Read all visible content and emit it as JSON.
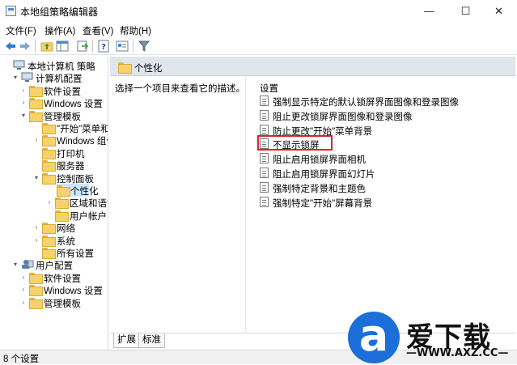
{
  "window": {
    "title": "本地组策略编辑器",
    "min_glyph": "—",
    "max_glyph": "☐",
    "close_glyph": "✕"
  },
  "menu": [
    "文件(F)",
    "操作(A)",
    "查看(V)",
    "帮助(H)"
  ],
  "tree": [
    {
      "label": "本地计算机 策略",
      "level": 0,
      "twisty": "",
      "icon": "computer-icon"
    },
    {
      "label": "计算机配置",
      "level": 1,
      "twisty": "▾",
      "icon": "computer-config-icon"
    },
    {
      "label": "软件设置",
      "level": 2,
      "twisty": "›",
      "icon": "folder-icon"
    },
    {
      "label": "Windows 设置",
      "level": 2,
      "twisty": "›",
      "icon": "folder-icon"
    },
    {
      "label": "管理模板",
      "level": 2,
      "twisty": "▾",
      "icon": "folder-icon"
    },
    {
      "label": "\"开始\"菜单和",
      "level": 3,
      "twisty": "",
      "icon": "folder-icon"
    },
    {
      "label": "Windows 组件",
      "level": 3,
      "twisty": "›",
      "icon": "folder-icon"
    },
    {
      "label": "打印机",
      "level": 3,
      "twisty": "",
      "icon": "folder-icon"
    },
    {
      "label": "服务器",
      "level": 3,
      "twisty": "",
      "icon": "folder-icon"
    },
    {
      "label": "控制面板",
      "level": 3,
      "twisty": "▾",
      "icon": "folder-icon"
    },
    {
      "label": "个性化",
      "level": 4,
      "twisty": "",
      "icon": "folder-open-icon",
      "selected": true
    },
    {
      "label": "区域和语言",
      "level": 4,
      "twisty": "›",
      "icon": "folder-icon"
    },
    {
      "label": "用户帐户",
      "level": 4,
      "twisty": "",
      "icon": "folder-icon"
    },
    {
      "label": "网络",
      "level": 3,
      "twisty": "›",
      "icon": "folder-icon"
    },
    {
      "label": "系统",
      "level": 3,
      "twisty": "›",
      "icon": "folder-icon"
    },
    {
      "label": "所有设置",
      "level": 3,
      "twisty": "",
      "icon": "folder-icon"
    },
    {
      "label": "用户配置",
      "level": 1,
      "twisty": "▾",
      "icon": "user-config-icon"
    },
    {
      "label": "软件设置",
      "level": 2,
      "twisty": "›",
      "icon": "folder-icon"
    },
    {
      "label": "Windows 设置",
      "level": 2,
      "twisty": "›",
      "icon": "folder-icon"
    },
    {
      "label": "管理模板",
      "level": 2,
      "twisty": "›",
      "icon": "folder-icon"
    }
  ],
  "right": {
    "header_title": "个性化",
    "description": "选择一个项目来查看它的描述。",
    "list_header": "设置",
    "settings": [
      "强制显示特定的默认锁屏界面图像和登录图像",
      "阻止更改锁屏界面图像和登录图像",
      "防止更改\"开始\"菜单背景",
      "不显示锁屏",
      "阻止启用锁屏界面相机",
      "阻止启用锁屏界面幻灯片",
      "强制特定背景和主题色",
      "强制特定\"开始\"屏幕背景"
    ],
    "highlighted_index": 3
  },
  "tabs": [
    "扩展",
    "标准"
  ],
  "status": "8 个设置",
  "watermark": {
    "mark": "a",
    "text": "爱下载",
    "url": "—WWW.AXZ.CC—"
  },
  "colors": {
    "accent": "#1c6fd8",
    "highlight_box": "#d9232e",
    "selection": "#cce8ff"
  }
}
